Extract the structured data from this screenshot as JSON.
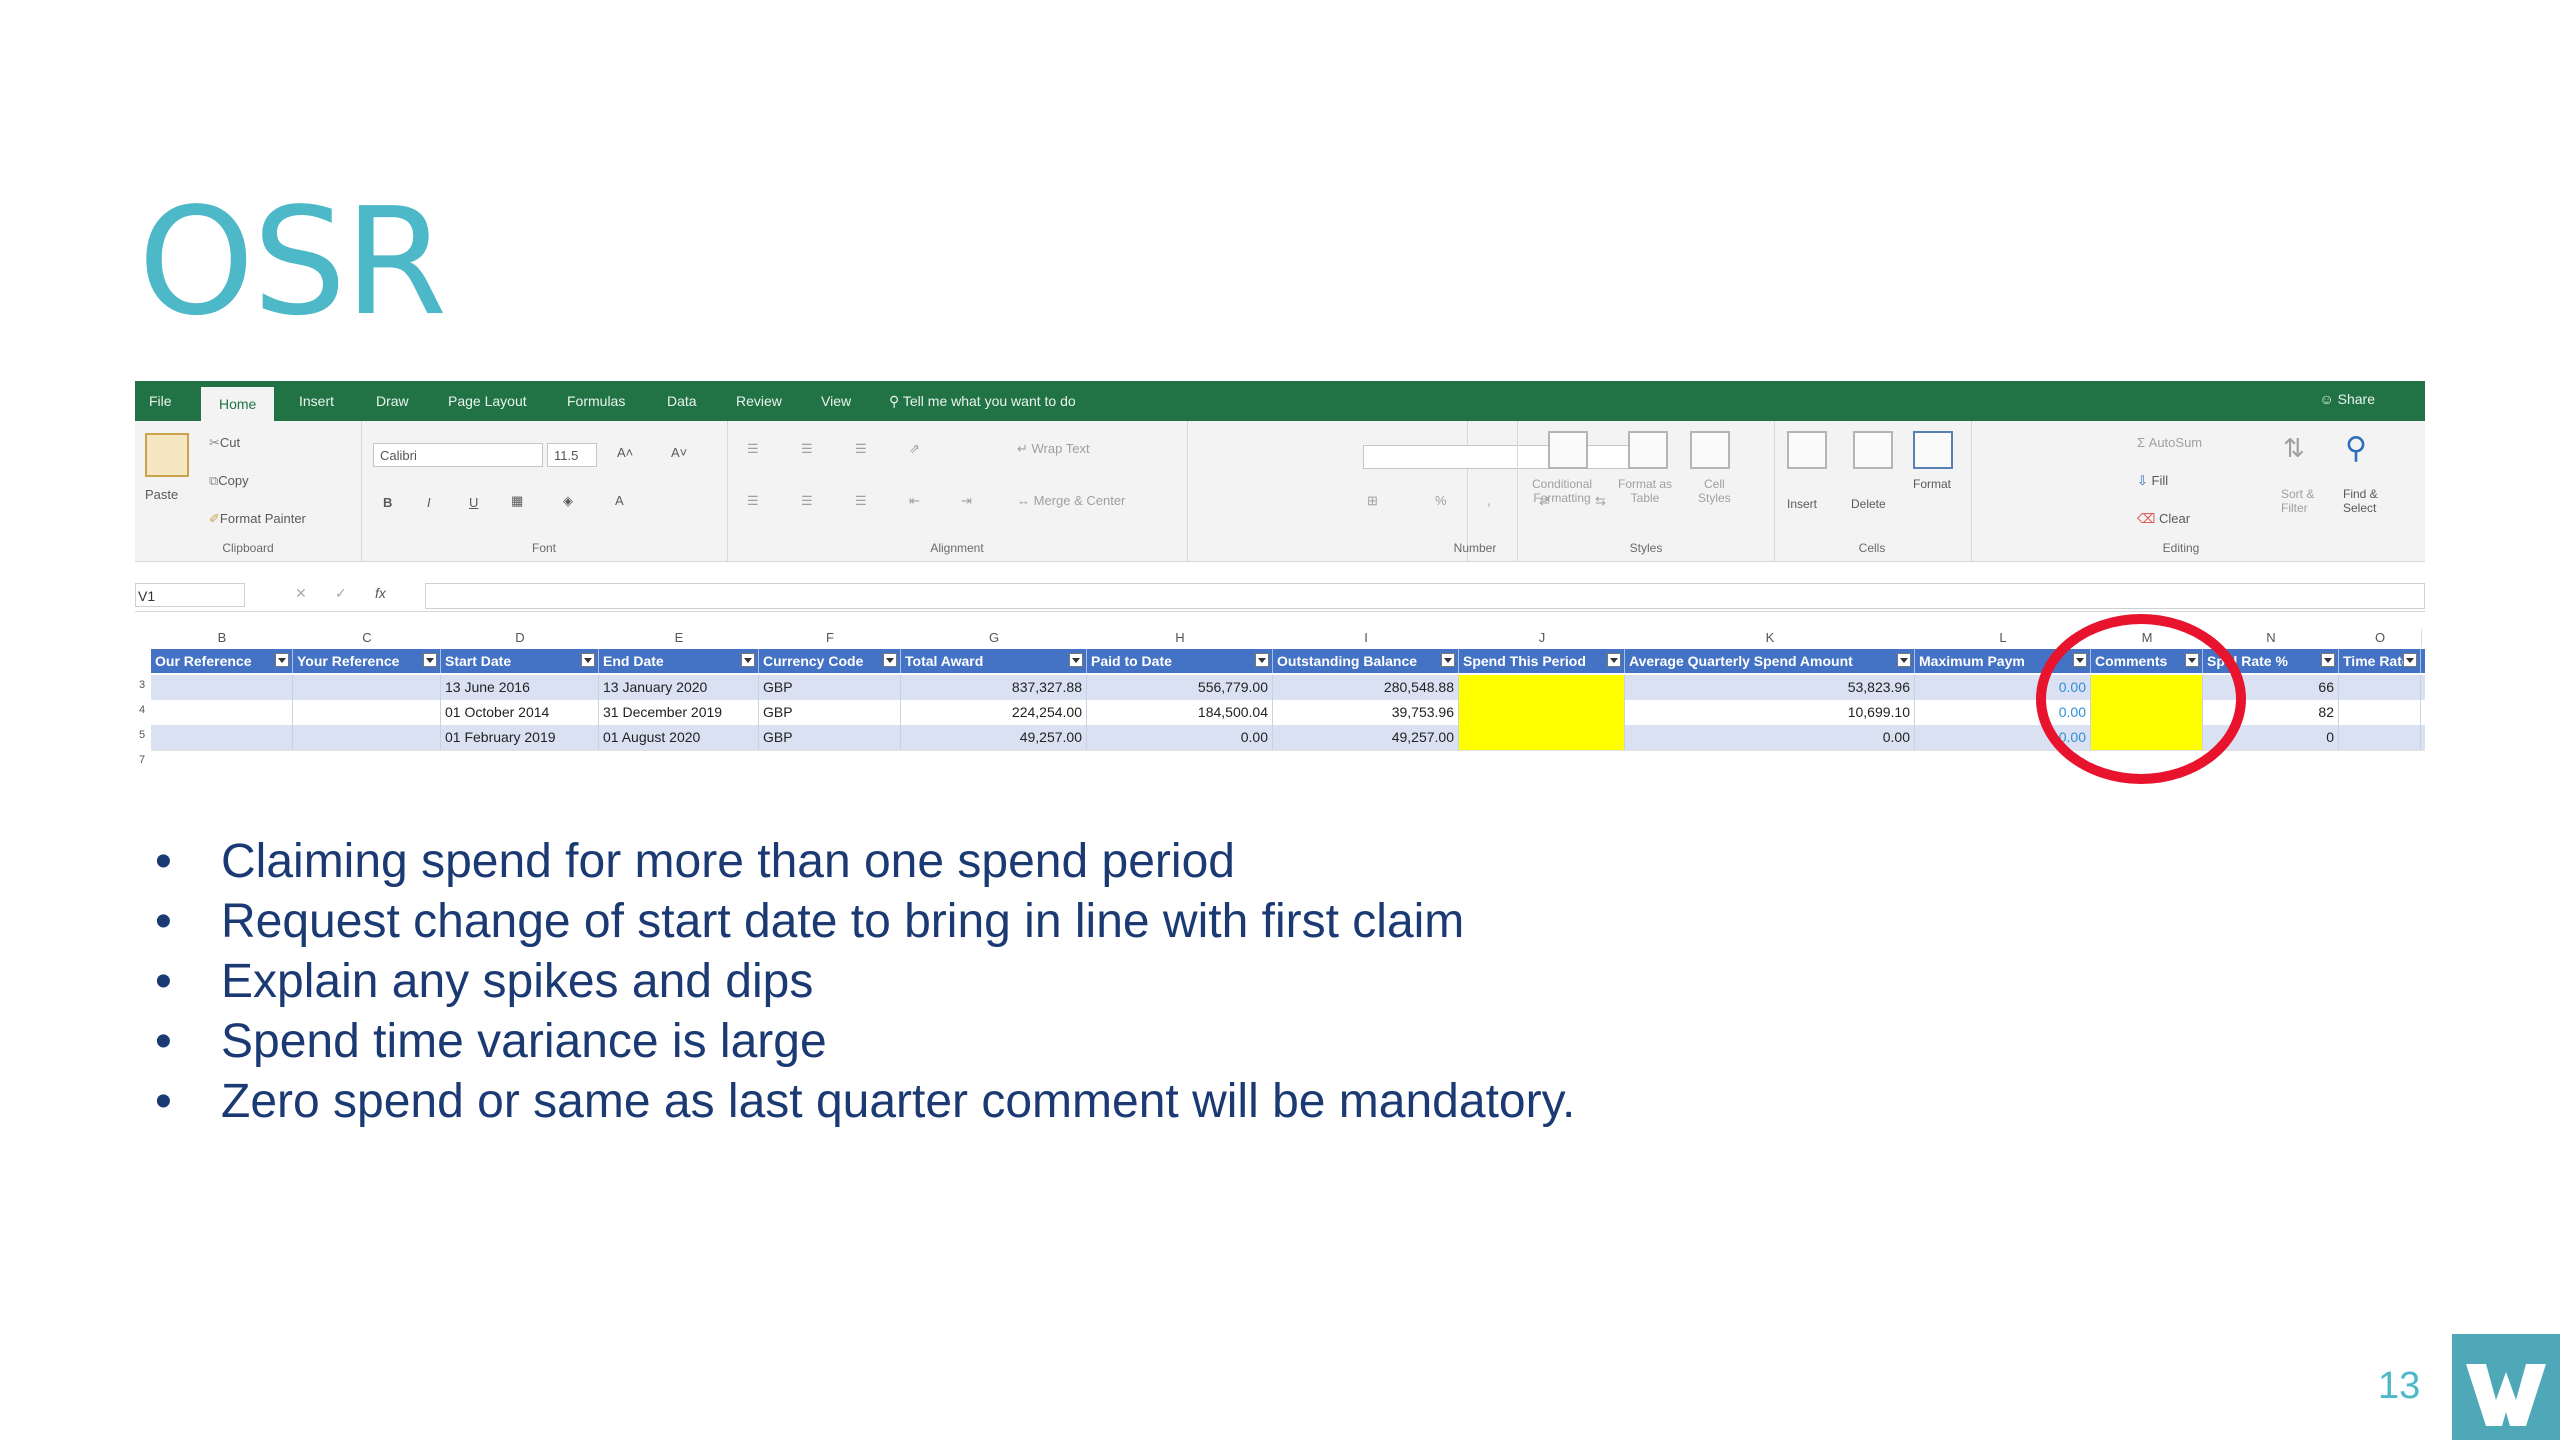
{
  "slide": {
    "title": "OSR",
    "page_number": "13",
    "bullets": [
      "Claiming spend for more than one spend period",
      "Request change of start date to bring in line with first claim",
      "Explain any spikes and dips",
      "Spend time variance is large",
      "Zero spend or same as last quarter comment will be mandatory."
    ]
  },
  "excel": {
    "tabs": [
      "File",
      "Home",
      "Insert",
      "Draw",
      "Page Layout",
      "Formulas",
      "Data",
      "Review",
      "View"
    ],
    "active_tab": "Home",
    "tell_me": "Tell me what you want to do",
    "share": "Share",
    "clipboard": {
      "paste": "Paste",
      "cut": "Cut",
      "copy": "Copy",
      "format_painter": "Format Painter",
      "label": "Clipboard"
    },
    "font": {
      "name": "Calibri",
      "size": "11.5",
      "bold": "B",
      "italic": "I",
      "underline": "U",
      "label": "Font"
    },
    "alignment": {
      "wrap_text": "Wrap Text",
      "merge_center": "Merge & Center",
      "label": "Alignment"
    },
    "number": {
      "format": "",
      "percent": "%",
      "comma": ",",
      "label": "Number"
    },
    "styles": {
      "conditional_line1": "Conditional",
      "conditional_line2": "Formatting",
      "format_table_line1": "Format as",
      "format_table_line2": "Table",
      "cell_styles_line1": "Cell",
      "cell_styles_line2": "Styles",
      "label": "Styles"
    },
    "cells": {
      "insert": "Insert",
      "delete": "Delete",
      "format": "Format",
      "label": "Cells"
    },
    "editing": {
      "autosum": "AutoSum",
      "fill": "Fill",
      "clear": "Clear",
      "sort_filter_line1": "Sort &",
      "sort_filter_line2": "Filter",
      "find_select_line1": "Find &",
      "find_select_line2": "Select",
      "label": "Editing"
    },
    "name_box": "V1",
    "fx": "fx",
    "column_letters": [
      "B",
      "C",
      "D",
      "E",
      "F",
      "G",
      "H",
      "I",
      "J",
      "K",
      "L",
      "M",
      "N",
      "O"
    ],
    "headers": [
      "Our Reference",
      "Your Reference",
      "Start Date",
      "End Date",
      "Currency Code",
      "Total Award",
      "Paid to Date",
      "Outstanding Balance",
      "Spend This Period",
      "Average Quarterly Spend Amount",
      "Maximum Paym",
      "Comments",
      "Sp   d Rate %",
      "Time Rate"
    ],
    "rows": [
      [
        "",
        "",
        "13 June 2016",
        "13 January 2020",
        "GBP",
        "837,327.88",
        "556,779.00",
        "280,548.88",
        "",
        "53,823.96",
        "0.00",
        "",
        "66",
        ""
      ],
      [
        "",
        "",
        "01 October 2014",
        "31 December 2019",
        "GBP",
        "224,254.00",
        "184,500.04",
        "39,753.96",
        "",
        "10,699.10",
        "0.00",
        "",
        "82",
        ""
      ],
      [
        "",
        "",
        "01 February 2019",
        "01 August 2020",
        "GBP",
        "49,257.00",
        "0.00",
        "49,257.00",
        "",
        "0.00",
        "0.00",
        "",
        "0",
        ""
      ]
    ],
    "row_numbers": [
      "3",
      "4",
      "5",
      "7"
    ]
  },
  "colors": {
    "title": "#4db8c7",
    "bullet_text": "#1b3a73",
    "excel_green": "#217346",
    "table_header": "#4472c4",
    "highlight": "#ffff00",
    "annotation_circle": "#e8132c"
  }
}
